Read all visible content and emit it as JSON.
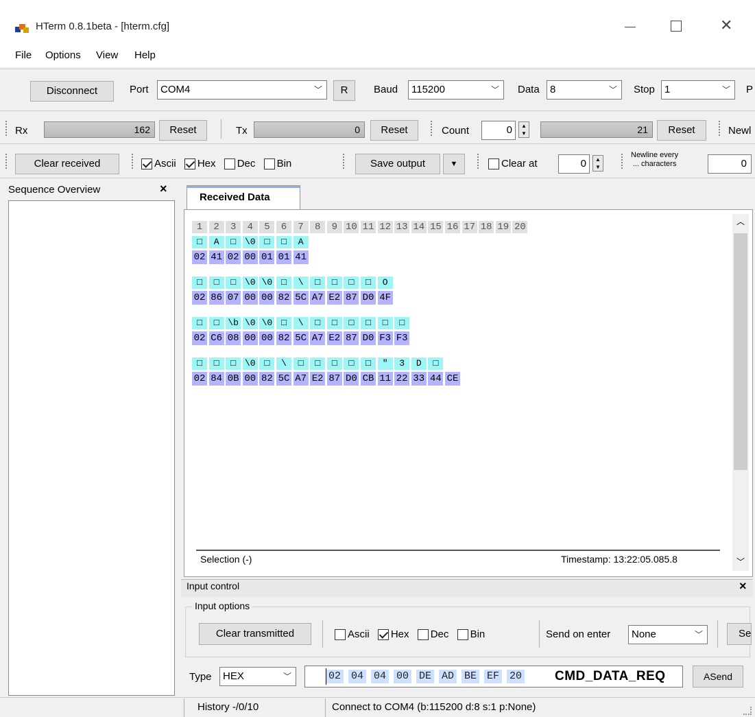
{
  "window": {
    "title": "HTerm 0.8.1beta - [hterm.cfg]"
  },
  "menu": [
    "File",
    "Options",
    "View",
    "Help"
  ],
  "connection": {
    "disconnect_label": "Disconnect",
    "port_label": "Port",
    "port_value": "COM4",
    "r_label": "R",
    "baud_label": "Baud",
    "baud_value": "115200",
    "data_label": "Data",
    "data_value": "8",
    "stop_label": "Stop",
    "stop_value": "1",
    "parity_label": "P"
  },
  "counters": {
    "rx_label": "Rx",
    "rx_value": "162",
    "rx_reset": "Reset",
    "tx_label": "Tx",
    "tx_value": "0",
    "tx_reset": "Reset",
    "count_label": "Count",
    "count_value": "0",
    "count_gauge": "21",
    "count_reset": "Reset",
    "newline_label": "Newl"
  },
  "display": {
    "clear_received": "Clear received",
    "ascii": "Ascii",
    "hex": "Hex",
    "dec": "Dec",
    "bin": "Bin",
    "ascii_checked": true,
    "hex_checked": true,
    "dec_checked": false,
    "bin_checked": false,
    "save_output": "Save output",
    "clear_at": "Clear at",
    "clear_at_value": "0",
    "newline_every_1": "Newline every",
    "newline_every_2": "... characters",
    "newline_value": "0"
  },
  "sequence_overview": {
    "title": "Sequence Overview",
    "close": "×"
  },
  "received": {
    "tab_label": "Received Data",
    "columns": [
      "1",
      "2",
      "3",
      "4",
      "5",
      "6",
      "7",
      "8",
      "9",
      "10",
      "11",
      "12",
      "13",
      "14",
      "15",
      "16",
      "17",
      "18",
      "19",
      "20"
    ],
    "rows": [
      {
        "ascii": [
          "□",
          "A",
          "□",
          "\\0",
          "□",
          "□",
          "A"
        ],
        "hex": [
          "02",
          "41",
          "02",
          "00",
          "01",
          "01",
          "41"
        ]
      },
      {
        "ascii": [
          "□",
          "□",
          "□",
          "\\0",
          "\\0",
          "□",
          "\\",
          "□",
          "□",
          "□",
          "□",
          "O"
        ],
        "hex": [
          "02",
          "86",
          "07",
          "00",
          "00",
          "82",
          "5C",
          "A7",
          "E2",
          "87",
          "D0",
          "4F"
        ]
      },
      {
        "ascii": [
          "□",
          "□",
          "\\b",
          "\\0",
          "\\0",
          "□",
          "\\",
          "□",
          "□",
          "□",
          "□",
          "□",
          "□"
        ],
        "hex": [
          "02",
          "C6",
          "08",
          "00",
          "00",
          "82",
          "5C",
          "A7",
          "E2",
          "87",
          "D0",
          "F3",
          "F3"
        ]
      },
      {
        "ascii": [
          "□",
          "□",
          "□",
          "\\0",
          "□",
          "\\",
          "□",
          "□",
          "□",
          "□",
          "□",
          "\"",
          "3",
          "D",
          "□"
        ],
        "hex": [
          "02",
          "84",
          "0B",
          "00",
          "82",
          "5C",
          "A7",
          "E2",
          "87",
          "D0",
          "CB",
          "11",
          "22",
          "33",
          "44",
          "CE"
        ]
      }
    ],
    "selection": "Selection (-)",
    "timestamp": "Timestamp: 13:22:05.085.8"
  },
  "input_control": {
    "title": "Input control",
    "close": "×",
    "options_label": "Input options",
    "clear_transmitted": "Clear transmitted",
    "ascii": "Ascii",
    "hex": "Hex",
    "dec": "Dec",
    "bin": "Bin",
    "ascii_checked": false,
    "hex_checked": true,
    "dec_checked": false,
    "bin_checked": false,
    "send_on_enter_label": "Send on enter",
    "send_on_enter_value": "None",
    "se_label": "Se",
    "type_label": "Type",
    "type_value": "HEX",
    "bytes": [
      "02",
      "04",
      "04",
      "00",
      "DE",
      "AD",
      "BE",
      "EF",
      "20"
    ],
    "annotation": "CMD_DATA_REQ",
    "asend": "ASend"
  },
  "status": {
    "history": "History -/0/10",
    "connect": "Connect to COM4 (b:115200 d:8 s:1 p:None)"
  }
}
